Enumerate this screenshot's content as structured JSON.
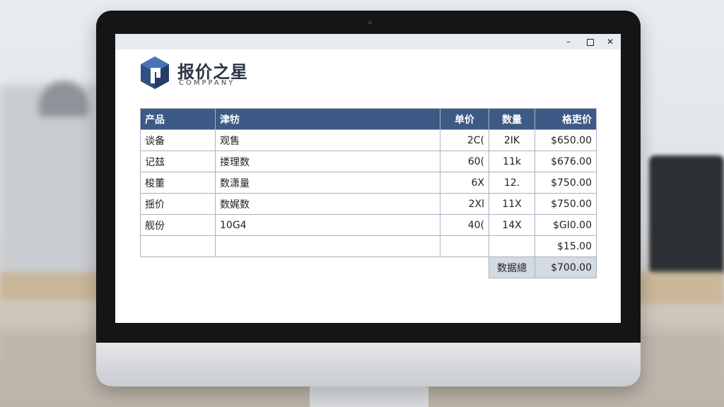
{
  "window": {
    "minimize_glyph": "–",
    "close_glyph": "✕"
  },
  "brand": {
    "name": "报价之星",
    "subtitle": "COMPPANY",
    "accent_color": "#2f4f85"
  },
  "table": {
    "header_color": "#3d5a86",
    "headers": [
      "产品",
      "津牥",
      "单价",
      "数量",
      "格吏价"
    ],
    "rows": [
      [
        "谈备",
        "观售",
        "2C(",
        "2IK",
        "$650.00"
      ],
      [
        "记玆",
        "搂理数",
        "60(",
        "11k",
        "$676.00"
      ],
      [
        "梭董",
        "数潇量",
        "6X",
        "12.",
        "$750.00"
      ],
      [
        "揺价",
        "数娓数",
        "2Xl",
        "11X",
        "$750.00"
      ],
      [
        "舰份",
        "10G4",
        "40(",
        "14X",
        "$GI0.00"
      ]
    ],
    "subtotal": "$15.00",
    "total_label": "数据總",
    "total_value": "$700.00"
  }
}
